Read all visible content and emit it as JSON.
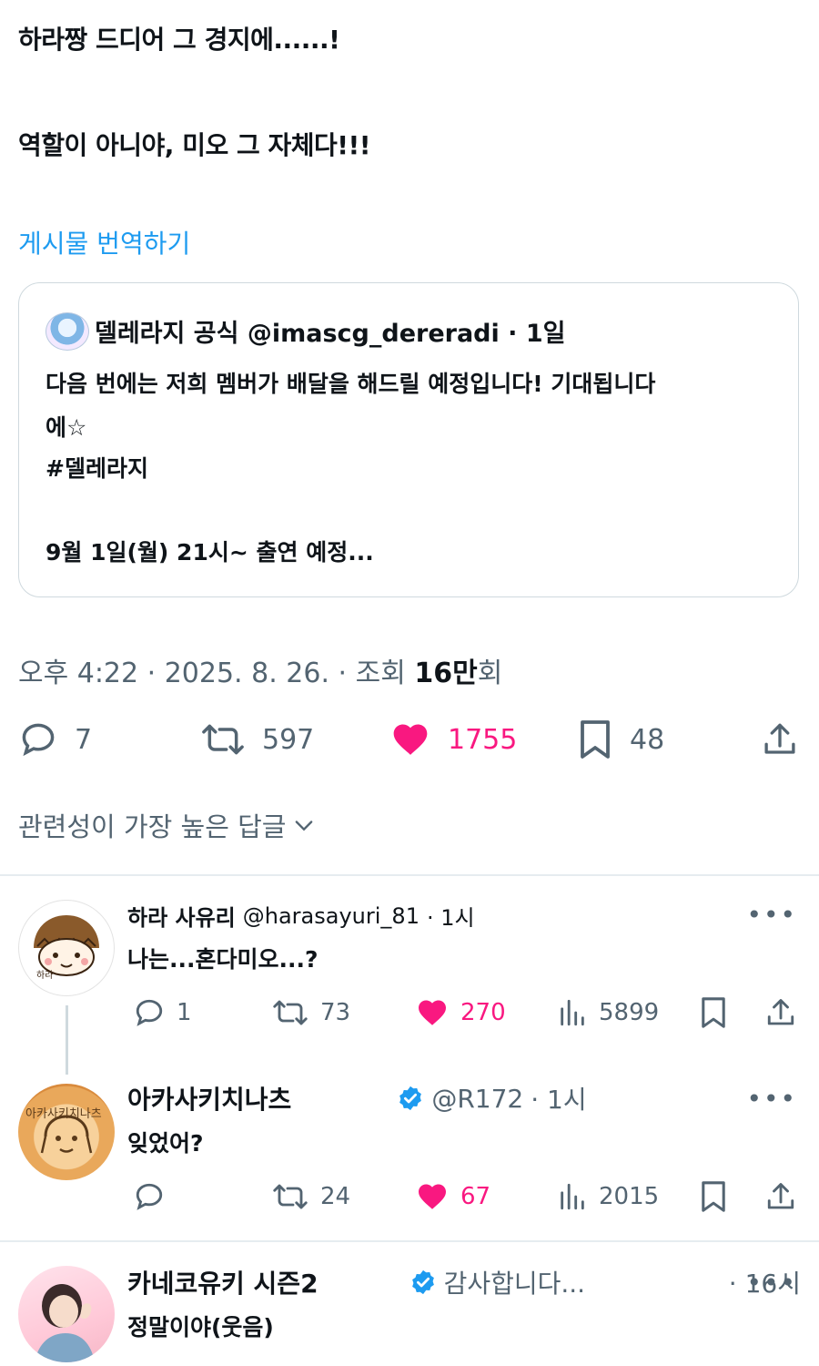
{
  "post": {
    "line1": "하라짱 드디어 그 경지에......!",
    "line2": "역할이 아니야, 미오 그 자체다!!!",
    "translate_label": "게시물 번역하기"
  },
  "quote": {
    "author_name": "델레라지 공식",
    "author_handle": "@imascg_dereradi",
    "time": "· 1일",
    "lines": [
      "다음 번에는 저희 멤버가 배달을 해드릴 예정입니다! 기대됩니다",
      "에☆",
      "#델레라지",
      "9월 1일(월) 21시~ 출연 예정..."
    ]
  },
  "meta": {
    "time": "오후 4:22 · 2025. 8. 26. · 조회 ",
    "views": "16만",
    "views_suffix": "회"
  },
  "actions": {
    "replies": "7",
    "reposts": "597",
    "likes": "1755",
    "bookmarks": "48"
  },
  "sort": {
    "label": "관련성이 가장 높은 답글"
  },
  "replies": [
    {
      "name": "하라 사유리",
      "handle": "@harasayuri_81",
      "time": "· 1시",
      "text": "나는...혼다미오...?",
      "avatar_text": "하라",
      "replies": "1",
      "reposts": "73",
      "likes": "270",
      "views": "5899"
    },
    {
      "name": "아카사키치나츠",
      "handle": "@R172",
      "time": "· 1시",
      "text": "잊었어?",
      "avatar_text": "아카사키치나츠",
      "replies": "",
      "reposts": "24",
      "likes": "67",
      "views": "2015"
    },
    {
      "name": "카네코유키 시즌2",
      "handle": "감사합니다...",
      "time": "· 16시",
      "text": "정말이야(웃음)"
    }
  ],
  "colors": {
    "accent": "#1d9bf0",
    "like": "#f91880",
    "muted": "#536471"
  }
}
